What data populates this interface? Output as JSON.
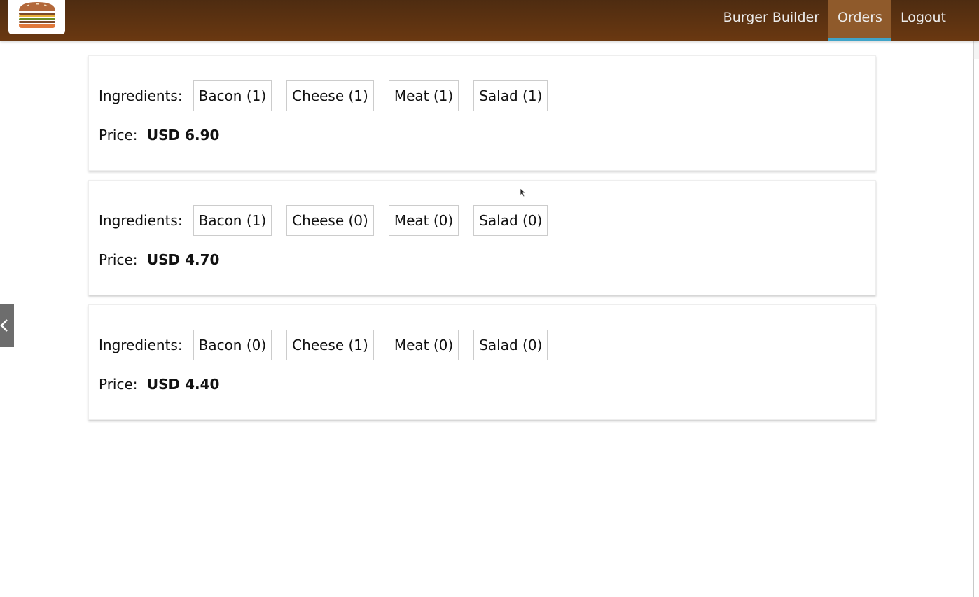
{
  "toolbar": {
    "logo_icon": "burger-logo-icon",
    "nav": [
      {
        "label": "Burger Builder",
        "active": false
      },
      {
        "label": "Orders",
        "active": true
      },
      {
        "label": "Logout",
        "active": false
      }
    ]
  },
  "orders": [
    {
      "ingredients_label": "Ingredients:",
      "ingredients": [
        "Bacon (1)",
        "Cheese (1)",
        "Meat (1)",
        "Salad (1)"
      ],
      "price_label": "Price:",
      "price_value": "USD 6.90"
    },
    {
      "ingredients_label": "Ingredients:",
      "ingredients": [
        "Bacon (1)",
        "Cheese (0)",
        "Meat (0)",
        "Salad (0)"
      ],
      "price_label": "Price:",
      "price_value": "USD 4.70"
    },
    {
      "ingredients_label": "Ingredients:",
      "ingredients": [
        "Bacon (0)",
        "Cheese (1)",
        "Meat (0)",
        "Salad (0)"
      ],
      "price_label": "Price:",
      "price_value": "USD 4.40"
    }
  ],
  "side_tab": {
    "icon": "chevron-left-icon"
  },
  "colors": {
    "toolbar_top": "#4e2c11",
    "toolbar_bottom": "#6a3811",
    "active_nav_bg": "#8f5a2b",
    "active_nav_underline": "#40a4c8"
  }
}
